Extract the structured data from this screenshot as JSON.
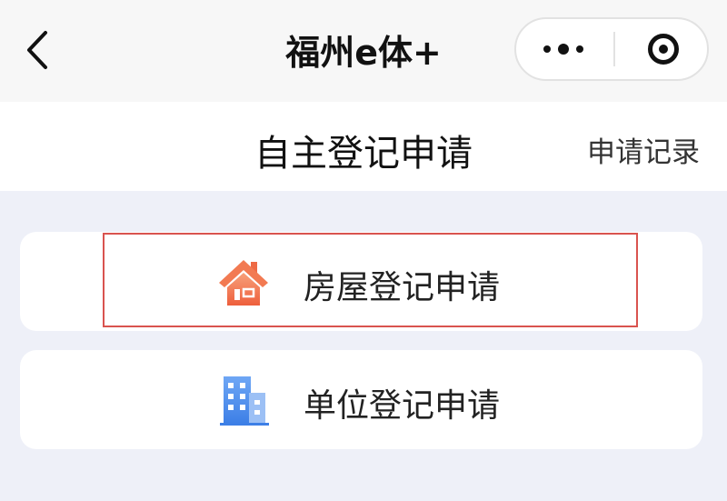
{
  "nav": {
    "title": "福州e体+",
    "back_icon": "chevron-left-icon",
    "more_icon": "more-dots-icon",
    "close_icon": "target-close-icon"
  },
  "header": {
    "title": "自主登记申请",
    "records_link": "申请记录"
  },
  "options": [
    {
      "label": "房屋登记申请",
      "icon": "house-icon",
      "icon_color": "#f0714b",
      "highlighted": true
    },
    {
      "label": "单位登记申请",
      "icon": "building-icon",
      "icon_color": "#4a8ef0",
      "highlighted": false
    }
  ],
  "colors": {
    "background": "#eef0f8",
    "highlight_border": "#d9534f"
  }
}
